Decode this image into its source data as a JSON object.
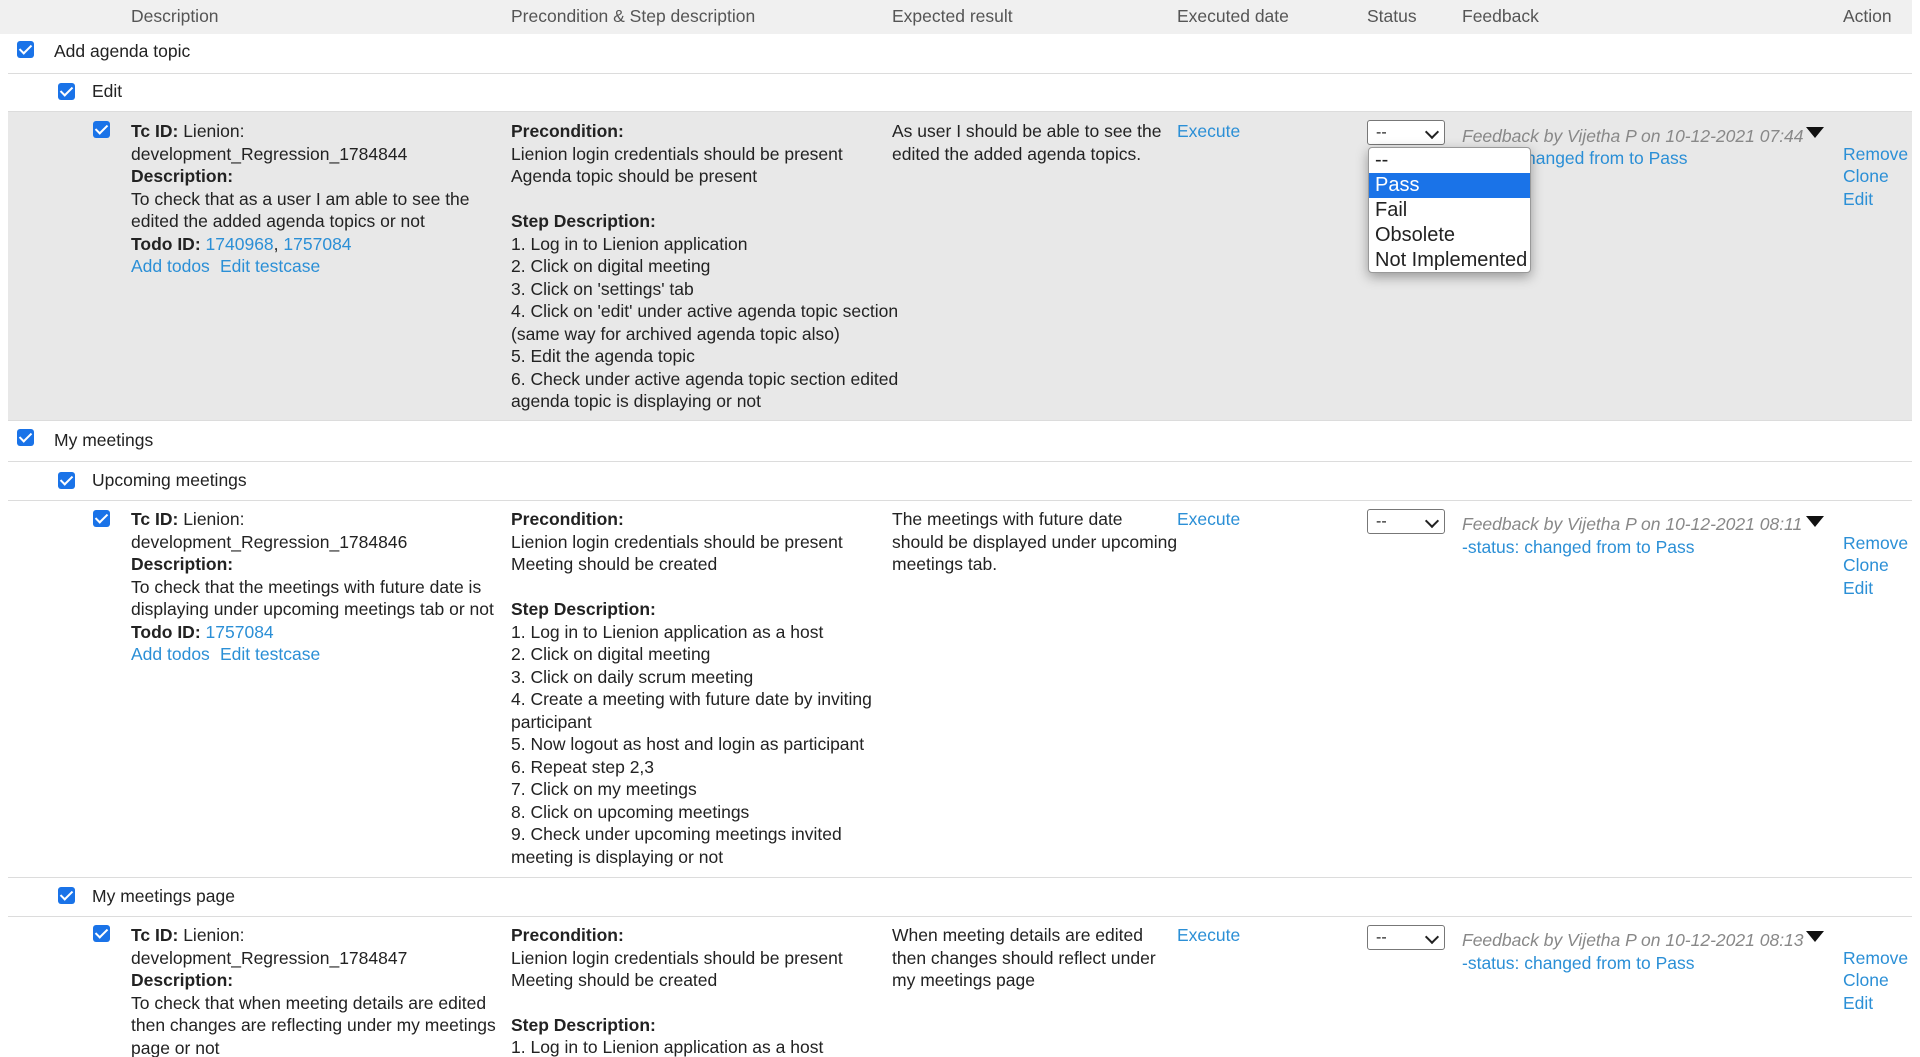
{
  "header": {
    "description": "Description",
    "precondition": "Precondition & Step description",
    "expected": "Expected result",
    "executed_date": "Executed date",
    "status": "Status",
    "feedback": "Feedback",
    "action": "Action"
  },
  "groups": [
    {
      "title": "Add agenda topic"
    },
    {
      "title": "My meetings"
    }
  ],
  "subgroups": [
    {
      "title": "Edit"
    },
    {
      "title": "Upcoming meetings"
    },
    {
      "title": "My meetings page"
    }
  ],
  "common": {
    "tc_id_label": "Tc ID:",
    "description_label": "Description:",
    "todo_id_label": "Todo ID:",
    "add_todos": "Add todos",
    "edit_testcase": "Edit testcase",
    "precondition_label": "Precondition:",
    "step_label": "Step Description:",
    "execute": "Execute",
    "remove": "Remove",
    "clone": "Clone",
    "edit": "Edit",
    "status_value": "--",
    "feedback_by": "Feedback by Vijetha P on",
    "status_change": "-status: changed from to Pass",
    "status_change_partial": "hanged from to Pass"
  },
  "cases": [
    {
      "tc_id_line1": "Lienion:",
      "tc_id_line2": "development_Regression_1784844",
      "desc_lines": [
        "To check that as a user I am able to see the",
        "edited the added agenda topics or not"
      ],
      "todo_ids": [
        "1740968",
        "1757084"
      ],
      "pre_lines": [
        "Lienion login credentials should be present",
        "Agenda topic should be present"
      ],
      "step_lines": [
        "1. Log in to Lienion application",
        "2. Click on digital meeting",
        "3. Click on 'settings' tab",
        "4. Click on 'edit' under active agenda topic section",
        "(same way for archived agenda topic also)",
        "5. Edit the agenda topic",
        "6. Check under active agenda topic section edited",
        "agenda topic is displaying or not"
      ],
      "expected_lines": [
        "As user I should be able to see the",
        "edited the added agenda topics."
      ],
      "feedback_time": "10-12-2021 07:44"
    },
    {
      "tc_id_line1": "Lienion:",
      "tc_id_line2": "development_Regression_1784846",
      "desc_lines": [
        "To check that the meetings with future date is",
        "displaying under upcoming meetings tab or not"
      ],
      "todo_ids": [
        "1757084"
      ],
      "pre_lines": [
        "Lienion login credentials should be present",
        "Meeting should be created"
      ],
      "step_lines": [
        "1. Log in to Lienion application as a host",
        "2. Click on digital meeting",
        "3. Click on daily scrum meeting",
        "4. Create a meeting with future date by inviting",
        "participant",
        "5. Now logout as host and login as participant",
        "6. Repeat step 2,3",
        "7. Click on my meetings",
        "8. Click on upcoming meetings",
        "9. Check under upcoming meetings invited",
        "meeting is displaying or not"
      ],
      "expected_lines": [
        "The meetings with future date",
        "should be displayed under upcoming",
        "meetings tab."
      ],
      "feedback_time": "10-12-2021 08:11"
    },
    {
      "tc_id_line1": "Lienion:",
      "tc_id_line2": "development_Regression_1784847",
      "desc_lines": [
        "To check that when meeting details are edited",
        "then changes are reflecting under my meetings",
        "page or not"
      ],
      "pre_lines": [
        "Lienion login credentials should be present",
        "Meeting should be created"
      ],
      "step_lines": [
        "1. Log in to Lienion application as a host"
      ],
      "expected_lines": [
        "When meeting details are edited",
        "then changes should reflect under",
        "my meetings page"
      ],
      "feedback_time": "10-12-2021 08:13"
    }
  ],
  "status_dropdown": {
    "options": [
      "--",
      "Pass",
      "Fail",
      "Obsolete",
      "Not Implemented"
    ],
    "highlighted": "Pass"
  }
}
